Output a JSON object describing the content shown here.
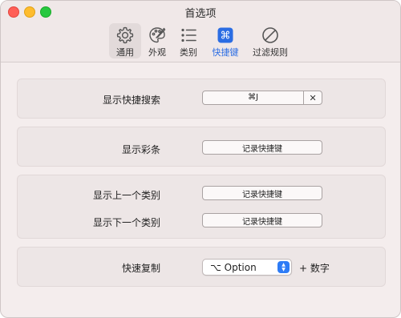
{
  "window": {
    "title": "首选项"
  },
  "toolbar": {
    "tabs": [
      {
        "label": "通用",
        "icon": "gear-icon"
      },
      {
        "label": "外观",
        "icon": "palette-icon"
      },
      {
        "label": "类别",
        "icon": "list-icon"
      },
      {
        "label": "快捷键",
        "icon": "command-key-icon"
      },
      {
        "label": "过滤规则",
        "icon": "prohibited-icon"
      }
    ],
    "selected_tab": "快捷键"
  },
  "colors": {
    "accent": "#2b6de3",
    "window_bg": "#f4eded"
  },
  "settings": {
    "show_search": {
      "label": "显示快捷搜索",
      "value": "⌘J",
      "clear": "✕"
    },
    "show_clips": {
      "label": "显示彩条",
      "value": "记录快捷键"
    },
    "prev_category": {
      "label": "显示上一个类别",
      "value": "记录快捷键"
    },
    "next_category": {
      "label": "显示下一个类别",
      "value": "记录快捷键"
    },
    "quick_copy": {
      "label": "快速复制",
      "modifier": "⌥ Option",
      "suffix": "+ 数字"
    }
  }
}
